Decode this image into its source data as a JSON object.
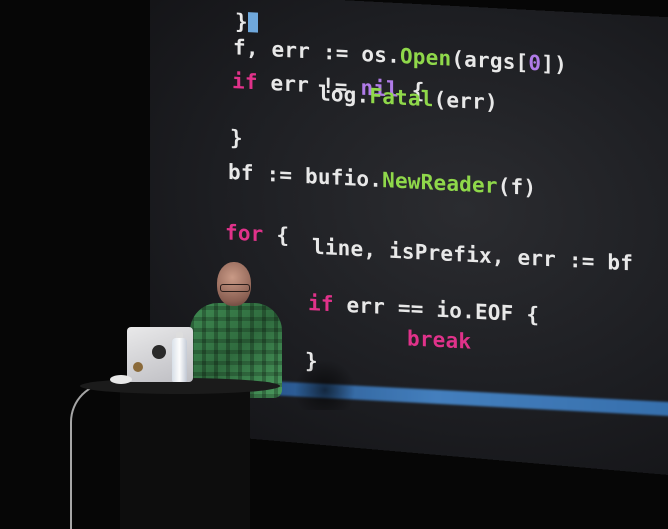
{
  "code": {
    "line1": "}",
    "line2_pre": "f, err := os.",
    "line2_fn": "Open",
    "line2_post": "(args[",
    "line2_num": "0",
    "line2_end": "])",
    "line3_kw": "if",
    "line3_mid": " err != ",
    "line3_nil": "nil",
    "line3_end": " {",
    "line4_pre": "log.",
    "line4_fn": "Fatal",
    "line4_end": "(err)",
    "line5": "}",
    "line6_pre": "bf := bufio.",
    "line6_fn": "NewReader",
    "line6_end": "(f)",
    "line7_kw": "for",
    "line7_end": " {",
    "line8": "line, isPrefix, err := bf",
    "line9_kw": "if",
    "line9_end": " err == io.EOF {",
    "line10_kw": "break",
    "line11": "}"
  },
  "colors": {
    "keyword": "#e0328a",
    "function": "#8fd84a",
    "number": "#b07be8",
    "cursor": "#6fa8dc"
  }
}
